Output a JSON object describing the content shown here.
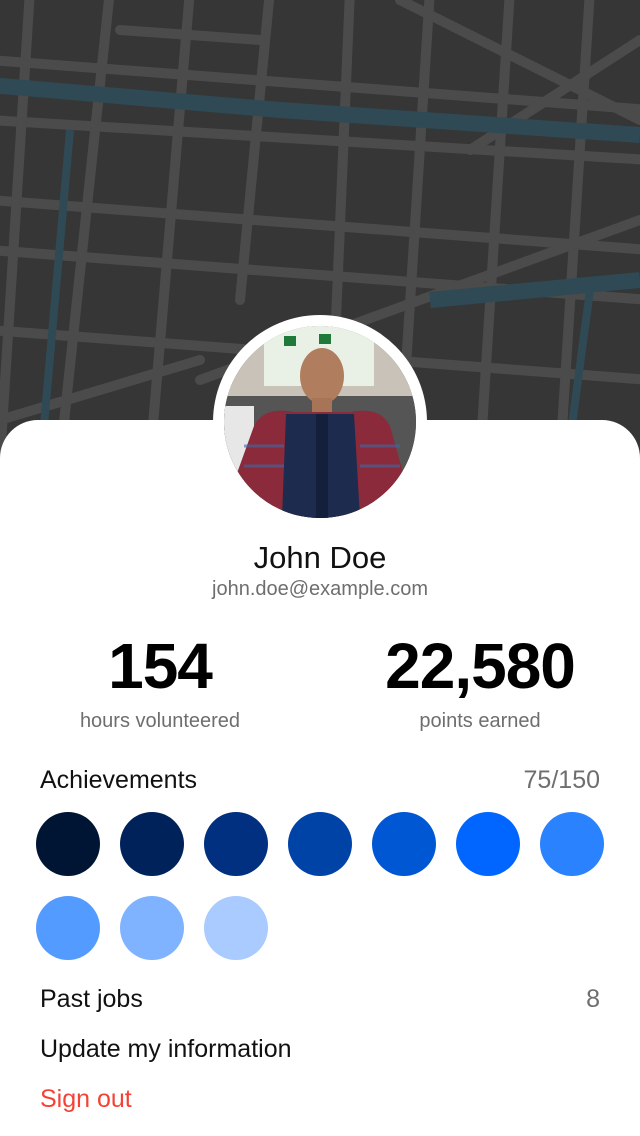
{
  "profile": {
    "name": "John Doe",
    "email": "john.doe@example.com"
  },
  "stats": {
    "hours_value": "154",
    "hours_label": "hours volunteered",
    "points_value": "22,580",
    "points_label": "points earned"
  },
  "achievements": {
    "title": "Achievements",
    "count": "75/150",
    "badges": [
      {
        "color": "#001533"
      },
      {
        "color": "#00225a"
      },
      {
        "color": "#00307f"
      },
      {
        "color": "#0043a6"
      },
      {
        "color": "#0057d4"
      },
      {
        "color": "#0066ff"
      },
      {
        "color": "#2b82ff"
      },
      {
        "color": "#549bff"
      },
      {
        "color": "#7fb3ff"
      },
      {
        "color": "#aacbff"
      }
    ]
  },
  "menu": {
    "past_jobs_label": "Past jobs",
    "past_jobs_count": "8",
    "update_info_label": "Update my information",
    "sign_out_label": "Sign out"
  },
  "colors": {
    "map_background": "#363636",
    "map_streets": "#4a4a4a",
    "map_water": "#2f4a55",
    "sign_out": "#f44336"
  }
}
